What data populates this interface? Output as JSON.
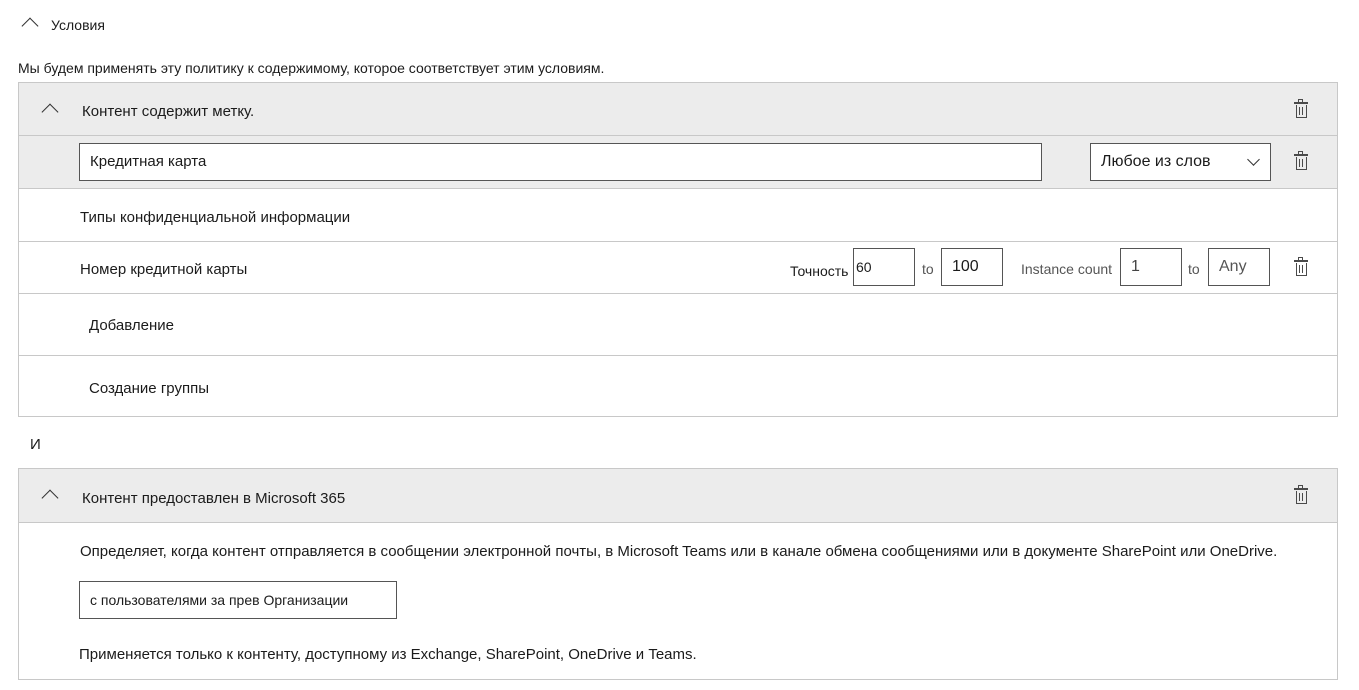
{
  "conditions": {
    "title": "Условия",
    "description": "Мы будем применять эту политику к содержимому, которое соответствует этим условиям."
  },
  "group1": {
    "header": "Контент содержит метку.",
    "label_value": "Кредитная карта",
    "match_select": "Любое из слов",
    "section_title": "Типы конфиденциальной информации",
    "sit": {
      "name": "Номер кредитной карты",
      "accuracy_label": "Точность",
      "accuracy_from": "60",
      "to1": "to",
      "accuracy_to": "100",
      "instance_label": "Instance count",
      "instance_from": "1",
      "to2": "to",
      "instance_to": "Any"
    },
    "add_label": "Добавление",
    "create_group_label": "Создание группы"
  },
  "operator": "И",
  "group2": {
    "header": "Контент предоставлен в Microsoft 365",
    "description": "Определяет, когда контент отправляется в сообщении электронной почты, в Microsoft Teams или в канале обмена сообщениями или в документе SharePoint или OneDrive.",
    "scope_value": "с пользователями за прев Организации",
    "note": "Применяется только к контенту, доступному из Exchange, SharePoint, OneDrive и Teams."
  },
  "icons": {
    "collapse": "chevron-up-icon",
    "dropdown": "chevron-down-icon",
    "delete": "trash-icon"
  }
}
